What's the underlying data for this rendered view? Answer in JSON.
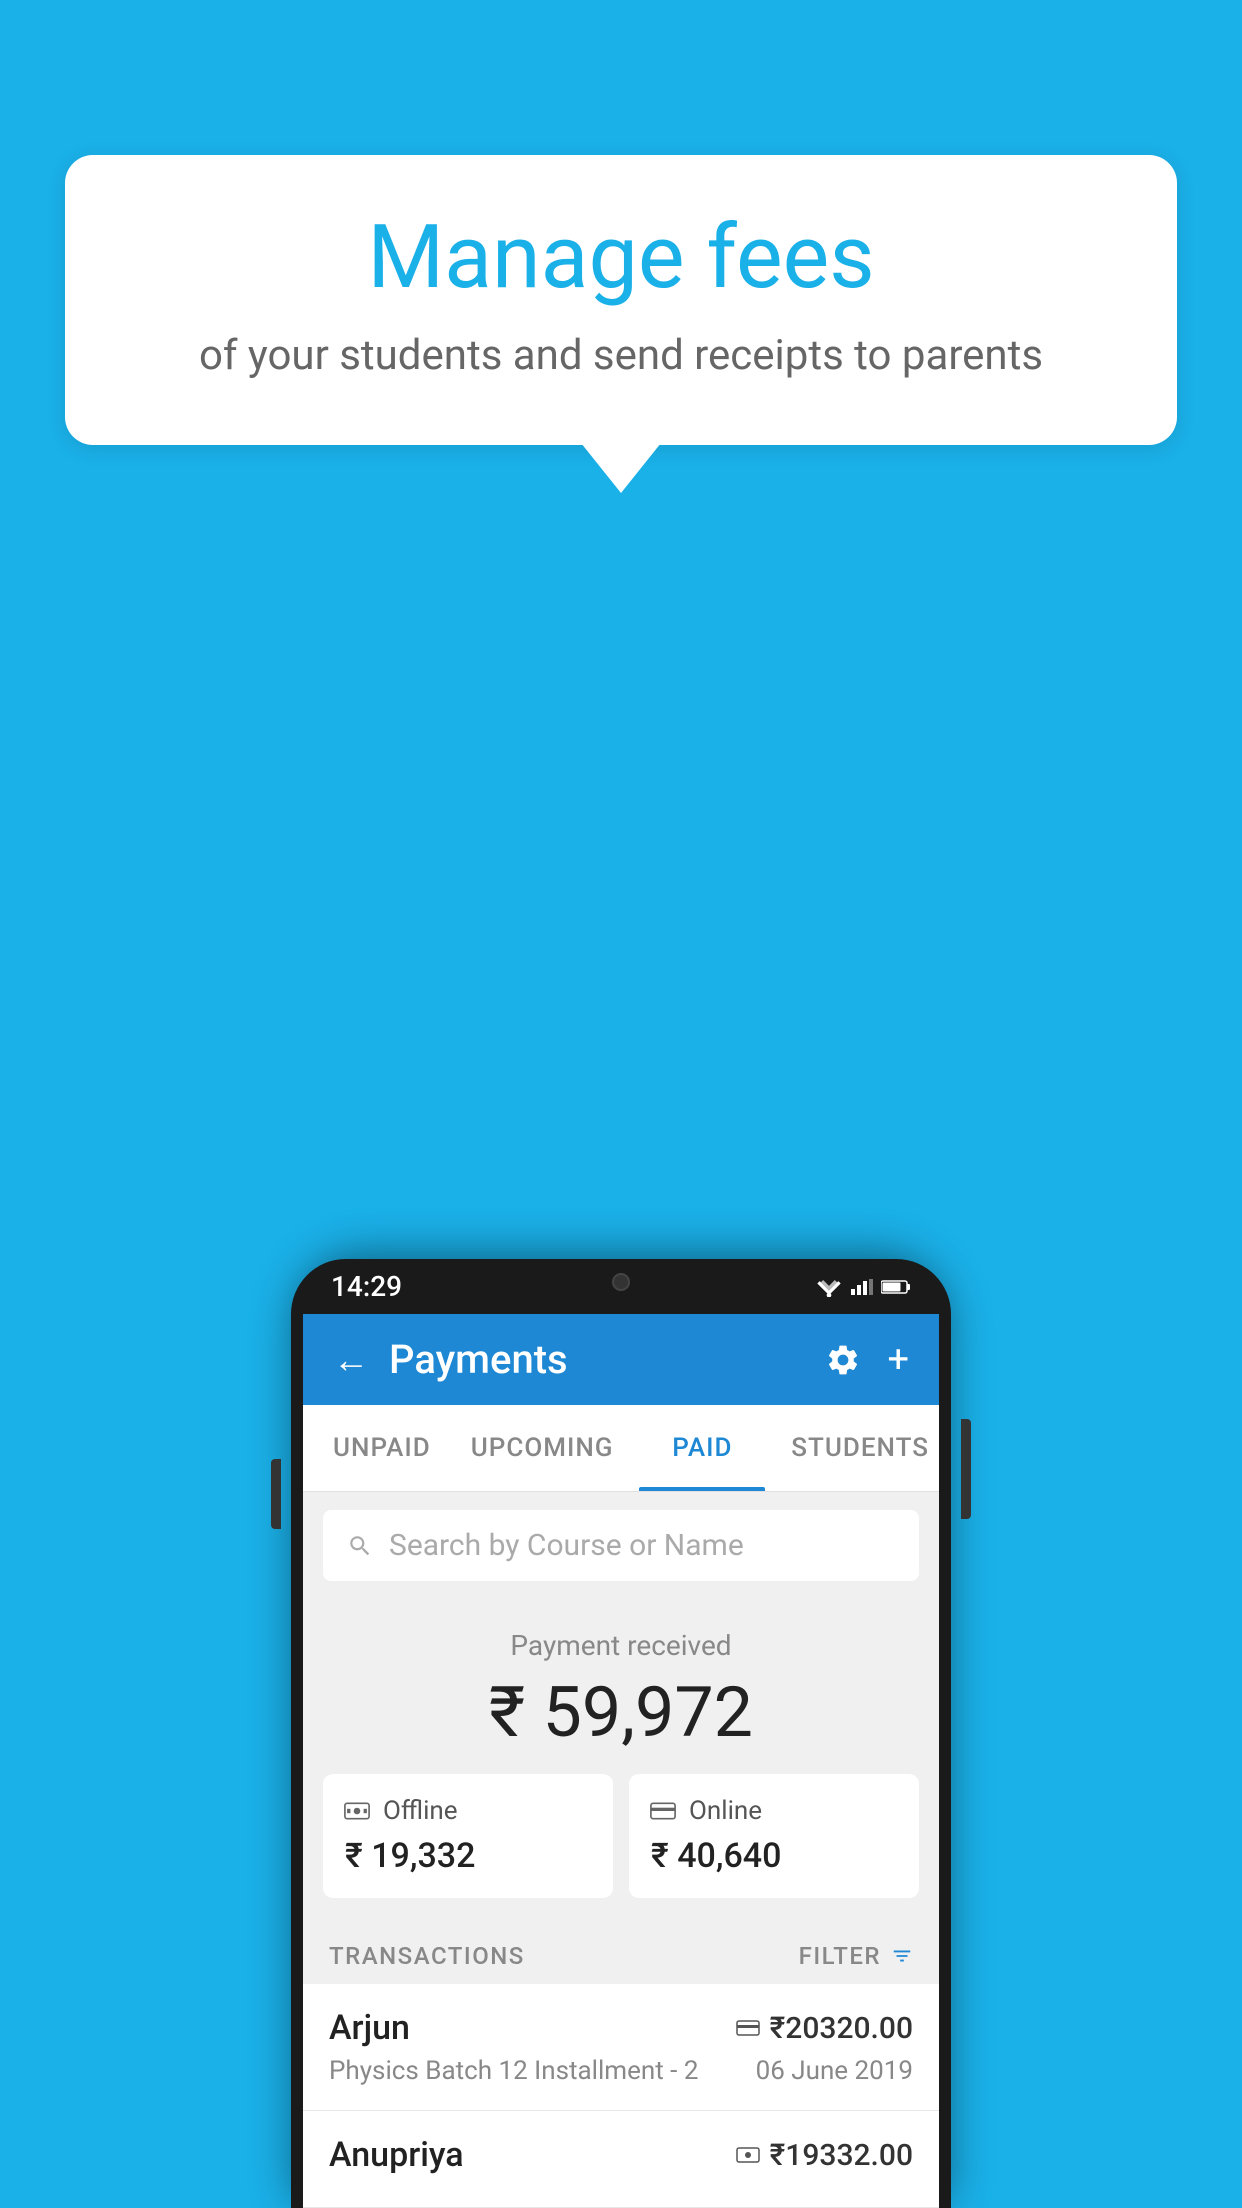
{
  "background_color": "#1ab0e8",
  "bubble": {
    "title": "Manage fees",
    "subtitle": "of your students and send receipts to parents"
  },
  "phone": {
    "status_time": "14:29",
    "header": {
      "title": "Payments",
      "back_label": "←",
      "settings_icon": "gear",
      "add_icon": "+"
    },
    "tabs": [
      {
        "label": "UNPAID",
        "active": false
      },
      {
        "label": "UPCOMING",
        "active": false
      },
      {
        "label": "PAID",
        "active": true
      },
      {
        "label": "STUDENTS",
        "active": false
      }
    ],
    "search": {
      "placeholder": "Search by Course or Name"
    },
    "payment_summary": {
      "label": "Payment received",
      "amount": "₹ 59,972",
      "offline": {
        "type": "Offline",
        "amount": "₹ 19,332"
      },
      "online": {
        "type": "Online",
        "amount": "₹ 40,640"
      }
    },
    "transactions": {
      "header_label": "TRANSACTIONS",
      "filter_label": "FILTER",
      "rows": [
        {
          "name": "Arjun",
          "course": "Physics Batch 12 Installment - 2",
          "amount": "₹20320.00",
          "date": "06 June 2019",
          "payment_type": "card"
        },
        {
          "name": "Anupriya",
          "course": "",
          "amount": "₹19332.00",
          "date": "",
          "payment_type": "cash"
        }
      ]
    }
  }
}
